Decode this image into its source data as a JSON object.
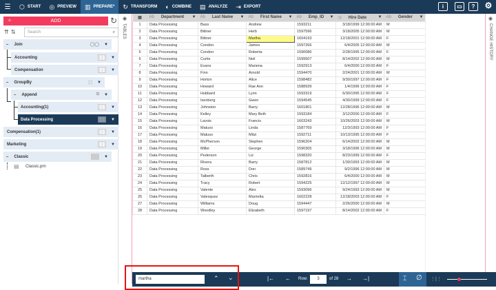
{
  "toolbar": {
    "items": [
      {
        "label": "START",
        "icon": "cube-icon"
      },
      {
        "label": "PREVIEW",
        "icon": "eye-icon"
      },
      {
        "label": "PREPARE*",
        "icon": "prepare-icon"
      },
      {
        "label": "TRANSFORM",
        "icon": "transform-icon"
      },
      {
        "label": "COMBINE",
        "icon": "combine-icon"
      },
      {
        "label": "ANALYZE",
        "icon": "clipboard-icon"
      },
      {
        "label": "EXPORT",
        "icon": "export-icon"
      }
    ]
  },
  "left": {
    "add_label": "ADD",
    "search_placeholder": "Search",
    "tree": [
      "Join",
      "Accounting",
      "Compensation",
      "GroupBy",
      "Append",
      "Accounting(1)",
      "Data Processing",
      "Compensation(1)",
      "Marketing",
      "Classic",
      "Classic.prn"
    ]
  },
  "side": {
    "tables": "TABLES",
    "history": "CHANGE HISTORY"
  },
  "grid": {
    "type_text": "Ab",
    "columns": [
      "Department",
      "Last Name",
      "First Name",
      "Emp_ID",
      "Hire Date",
      "Gender"
    ],
    "rows": [
      [
        "Data Processing",
        "Bass",
        "Andrew",
        "1593211",
        "3/18/1999 12:00:00 AM",
        "M"
      ],
      [
        "Data Processing",
        "Bittner",
        "Herb",
        "1597596",
        "3/18/2005 12:00:00 AM",
        "M"
      ],
      [
        "Data Processing",
        "Bittner",
        "Martha",
        "1604193",
        "12/18/2001 12:00:00 AM",
        "F"
      ],
      [
        "Data Processing",
        "Condon",
        "James",
        "1597266",
        "6/4/2005 12:00:00 AM",
        "M"
      ],
      [
        "Data Processing",
        "Condon",
        "Roberta",
        "1590086",
        "2/28/1995 12:00:00 AM",
        "F"
      ],
      [
        "Data Processing",
        "Curtis",
        "Neil",
        "1599507",
        "8/14/2002 12:00:00 AM",
        "M"
      ],
      [
        "Data Processing",
        "Evans",
        "Mariena",
        "1592913",
        "6/4/2000 12:00:00 AM",
        "F"
      ],
      [
        "Data Processing",
        "Finn",
        "Arnold",
        "1594470",
        "2/24/2001 12:00:00 AM",
        "M"
      ],
      [
        "Data Processing",
        "Horton",
        "Alice",
        "1598482",
        "9/30/1997 12:00:00 AM",
        "F"
      ],
      [
        "Data Processing",
        "Howard",
        "Rae Ann",
        "1588939",
        "1/4/1996 12:00:00 AM",
        "F"
      ],
      [
        "Data Processing",
        "Hubbard",
        "Lynn",
        "1593319",
        "6/30/1995 12:00:00 AM",
        "F"
      ],
      [
        "Data Processing",
        "Isenberg",
        "Gwen",
        "1594545",
        "4/30/1999 12:00:00 AM",
        "F"
      ],
      [
        "Data Processing",
        "Johnston",
        "Barry",
        "1601801",
        "12/28/1996 12:00:00 AM",
        "M"
      ],
      [
        "Data Processing",
        "Kelley",
        "Mary Beth",
        "1593184",
        "3/12/2000 12:00:00 AM",
        "F"
      ],
      [
        "Data Processing",
        "Lavois",
        "Francis",
        "1603243",
        "10/26/2003 12:00:00 AM",
        "M"
      ],
      [
        "Data Processing",
        "Matuso",
        "Linda",
        "1587769",
        "12/3/1993 12:00:00 AM",
        "F"
      ],
      [
        "Data Processing",
        "Matuso",
        "Mitzi",
        "1592711",
        "10/13/1995 12:00:00 AM",
        "F"
      ],
      [
        "Data Processing",
        "McPherson",
        "Stephen",
        "1596204",
        "6/14/2002 12:00:00 AM",
        "M"
      ],
      [
        "Data Processing",
        "Miller",
        "George",
        "1590305",
        "3/18/1996 12:00:00 AM",
        "M"
      ],
      [
        "Data Processing",
        "Pederson",
        "Liz",
        "1598320",
        "8/23/1999 12:00:00 AM",
        "F"
      ],
      [
        "Data Processing",
        "Rivera",
        "Barry",
        "1587812",
        "1/30/1993 12:00:00 AM",
        "M"
      ],
      [
        "Data Processing",
        "Ross",
        "Don",
        "1589749",
        "9/2/1996 12:00:00 AM",
        "M"
      ],
      [
        "Data Processing",
        "Talberth",
        "Chris",
        "1592816",
        "6/4/2000 12:00:00 AM",
        "M"
      ],
      [
        "Data Processing",
        "Tracy",
        "Robert",
        "1594225",
        "12/12/1997 12:00:00 AM",
        "M"
      ],
      [
        "Data Processing",
        "Valente",
        "Alex",
        "1593096",
        "9/24/1993 12:00:00 AM",
        "M"
      ],
      [
        "Data Processing",
        "Valesquez",
        "Marrietta",
        "1602228",
        "12/18/2003 12:00:00 AM",
        "F"
      ],
      [
        "Data Processing",
        "Williams",
        "Doug",
        "1594447",
        "2/26/2000 12:00:00 AM",
        "M"
      ],
      [
        "Data Processing",
        "Woodley",
        "Elizabeth",
        "1597197",
        "8/14/2002 12:00:00 AM",
        "F"
      ]
    ]
  },
  "bottom": {
    "find_value": "martha",
    "row_label": "Row:",
    "row_value": "3",
    "of_label": "of 28",
    "zoom_percent": 30
  },
  "colors": {
    "navy": "#1b3a57",
    "accent": "#f23b5e",
    "highlight": "#fdfa8c"
  }
}
